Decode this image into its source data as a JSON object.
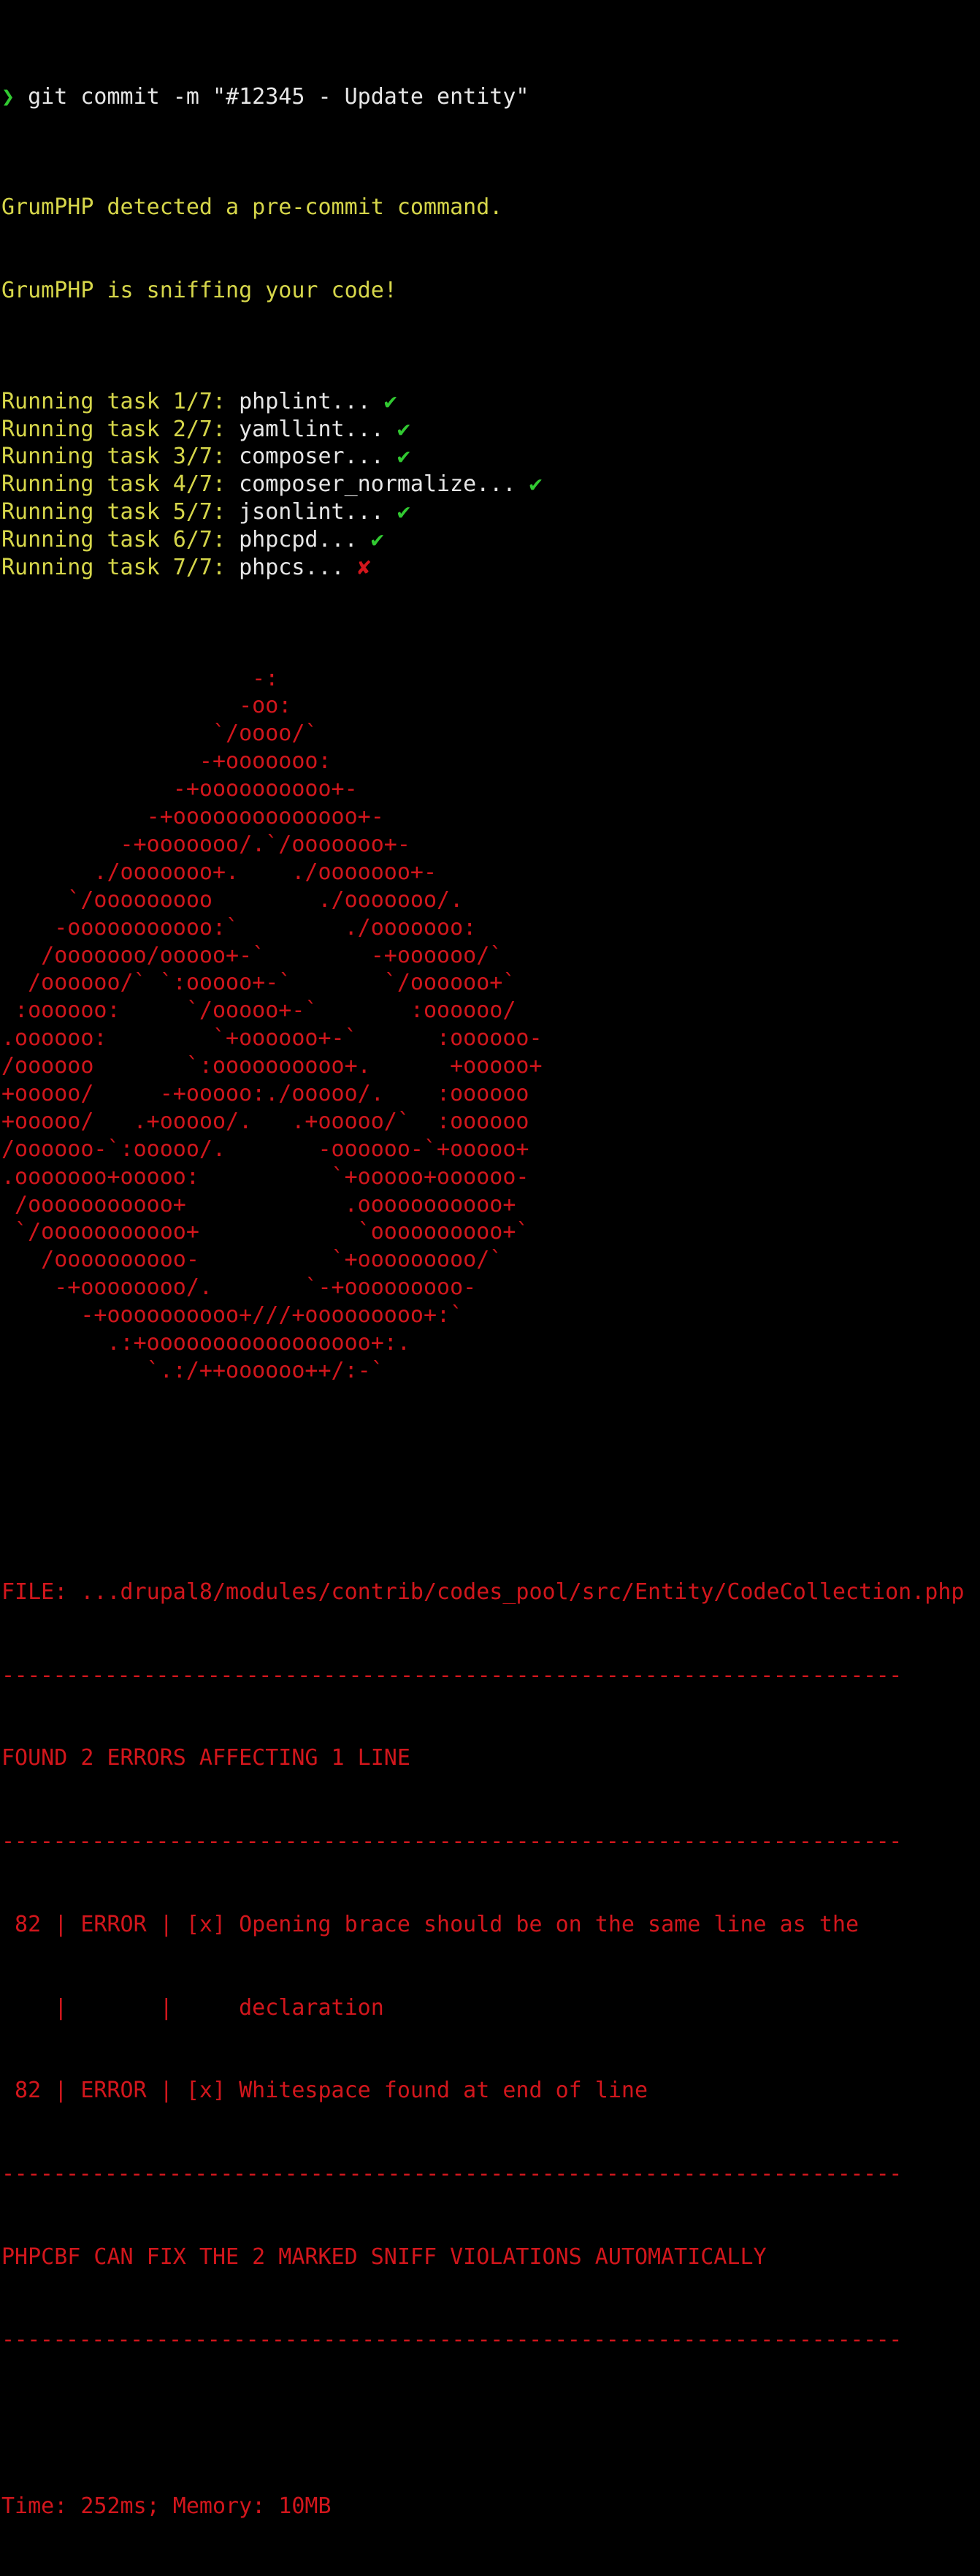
{
  "prompt": {
    "symbol": "❯",
    "command": " git commit -m \"#12345 - Update entity\""
  },
  "intro": [
    "GrumPHP detected a pre-commit command.",
    "GrumPHP is sniffing your code!"
  ],
  "tasks": [
    {
      "prefix": "Running task 1/7: ",
      "name": "phplint...",
      "status": "✔",
      "ok": true
    },
    {
      "prefix": "Running task 2/7: ",
      "name": "yamllint...",
      "status": "✔",
      "ok": true
    },
    {
      "prefix": "Running task 3/7: ",
      "name": "composer...",
      "status": "✔",
      "ok": true
    },
    {
      "prefix": "Running task 4/7: ",
      "name": "composer_normalize...",
      "status": "✔",
      "ok": true
    },
    {
      "prefix": "Running task 5/7: ",
      "name": "jsonlint...",
      "status": "✔",
      "ok": true
    },
    {
      "prefix": "Running task 6/7: ",
      "name": "phpcpd...",
      "status": "✔",
      "ok": true
    },
    {
      "prefix": "Running task 7/7: ",
      "name": "phpcs...",
      "status": "✘",
      "ok": false
    }
  ],
  "ascii_art": [
    "                   -:",
    "                  -oo:",
    "                `/oooo/`",
    "               -+ooooooo:",
    "             -+oooooooooo+-",
    "           -+oooooooooooooo+-",
    "         -+ooooooo/.`/ooooooo+-",
    "       ./ooooooo+.    ./ooooooo+-",
    "     `/ooooooooo        ./ooooooo/.",
    "    -ooooooooooo:`        ./ooooooo:",
    "   /ooooooo/ooooo+-`        -+oooooo/`",
    "  /oooooo/` `:ooooo+-`       `/oooooo+`",
    " :oooooo:     `/ooooo+-`       :oooooo/",
    ".oooooo:        `+oooooo+-`      :oooooo-",
    "/oooooo       `:oooooooooo+.      +ooooo+",
    "+ooooo/     -+ooooo:./ooooo/.    :oooooo",
    "+ooooo/   .+ooooo/.   .+ooooo/`  :oooooo",
    "/oooooo-`:ooooo/.       -oooooo-`+ooooo+",
    ".ooooooo+ooooo:          `+ooooo+oooooo-",
    " /ooooooooooo+            .ooooooooooo+",
    " `/ooooooooooo+            `oooooooooo+`",
    "   /oooooooooo-          `+ooooooooo/`",
    "    -+oooooooo/.       `-+ooooooooo-",
    "      -+oooooooooo+///+ooooooooo+:`",
    "        .:+ooooooooooooooooo+:.",
    "           `.:/++oooooo++/:-`"
  ],
  "report": {
    "file_line": "FILE: ...drupal8/modules/contrib/codes_pool/src/Entity/CodeCollection.php",
    "separator": "----------------------------------------------------------------------",
    "found_line": "FOUND 2 ERRORS AFFECTING 1 LINE",
    "errors": [
      " 82 | ERROR | [x] Opening brace should be on the same line as the",
      "    |       |     declaration",
      " 82 | ERROR | [x] Whitespace found at end of line"
    ],
    "fix_line": "PHPCBF CAN FIX THE 2 MARKED SNIFF VIOLATIONS AUTOMATICALLY",
    "time_line": "Time: 252ms; Memory: 10MB"
  }
}
